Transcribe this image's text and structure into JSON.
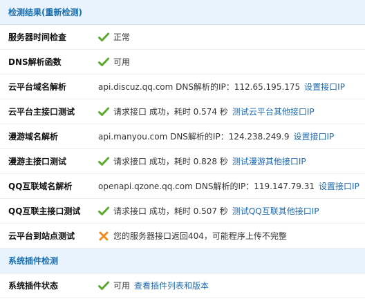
{
  "header1": {
    "title": "检测结果",
    "recheck_link": "(重新检测)"
  },
  "rows": [
    {
      "label": "服务器时间检查",
      "icon": "check-icon",
      "text": "正常"
    },
    {
      "label": "DNS解析函数",
      "icon": "check-icon",
      "text": "可用"
    },
    {
      "label": "云平台域名解析",
      "text": "api.discuz.qq.com DNS解析的IP：112.65.195.175",
      "link": "设置接口IP"
    },
    {
      "label": "云平台主接口测试",
      "icon": "check-icon",
      "text": "请求接口 成功，耗时 0.574 秒",
      "link": "测试云平台其他接口IP"
    },
    {
      "label": "漫游域名解析",
      "text": "api.manyou.com DNS解析的IP：124.238.249.9",
      "link": "设置接口IP"
    },
    {
      "label": "漫游主接口测试",
      "icon": "check-icon",
      "text": "请求接口 成功，耗时 0.828 秒",
      "link": "测试漫游其他接口IP"
    },
    {
      "label": "QQ互联域名解析",
      "text": "openapi.qzone.qq.com DNS解析的IP：119.147.79.31",
      "link": "设置接口IP"
    },
    {
      "label": "QQ互联主接口测试",
      "icon": "check-icon",
      "text": "请求接口 成功，耗时 0.507 秒",
      "link": "测试QQ互联其他接口IP"
    },
    {
      "label": "云平台到站点测试",
      "icon": "cross-icon",
      "text": "您的服务器接口返回404，可能程序上传不完整"
    }
  ],
  "header2": {
    "title": "系统插件检测"
  },
  "plugin_row": {
    "label": "系统插件状态",
    "icon": "check-icon",
    "text": "可用",
    "link": "查看插件列表和版本"
  },
  "colors": {
    "check": "#5aa82d",
    "cross": "#f08a1c",
    "link": "#1d6ab0",
    "header_bg": "#e8f3fd",
    "header_text": "#1a6fb0"
  }
}
